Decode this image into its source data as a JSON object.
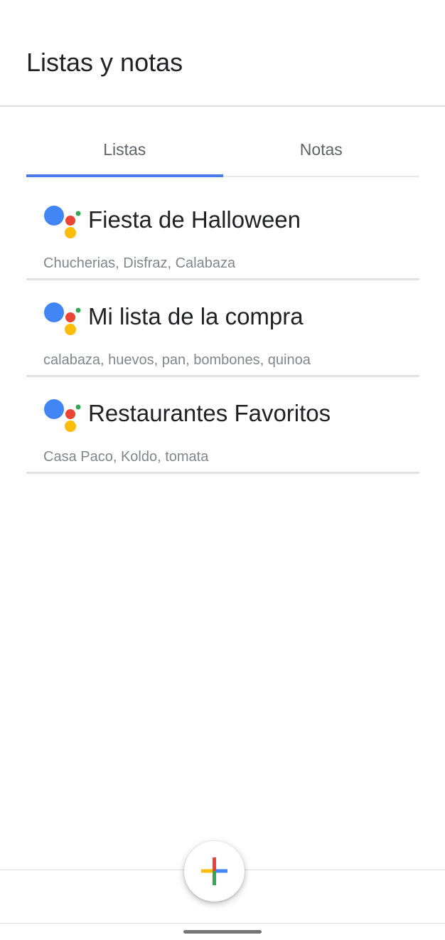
{
  "header": {
    "title": "Listas y notas"
  },
  "tabs": [
    {
      "label": "Listas",
      "active": true
    },
    {
      "label": "Notas",
      "active": false
    }
  ],
  "lists": [
    {
      "title": "Fiesta de Halloween",
      "items": "Chucherias, Disfraz, Calabaza",
      "icon": "google-assistant-icon"
    },
    {
      "title": "Mi lista de la compra",
      "items": "calabaza, huevos, pan, bombones, quinoa",
      "icon": "google-assistant-icon"
    },
    {
      "title": "Restaurantes Favoritos",
      "items": "Casa Paco, Koldo, tomata",
      "icon": "google-assistant-icon"
    }
  ],
  "fab": {
    "icon": "add-icon"
  },
  "colors": {
    "accent": "#4a7bec",
    "assistant_blue": "#4285f4",
    "assistant_red": "#ea4335",
    "assistant_yellow": "#fbbc05",
    "assistant_green": "#34a853"
  }
}
